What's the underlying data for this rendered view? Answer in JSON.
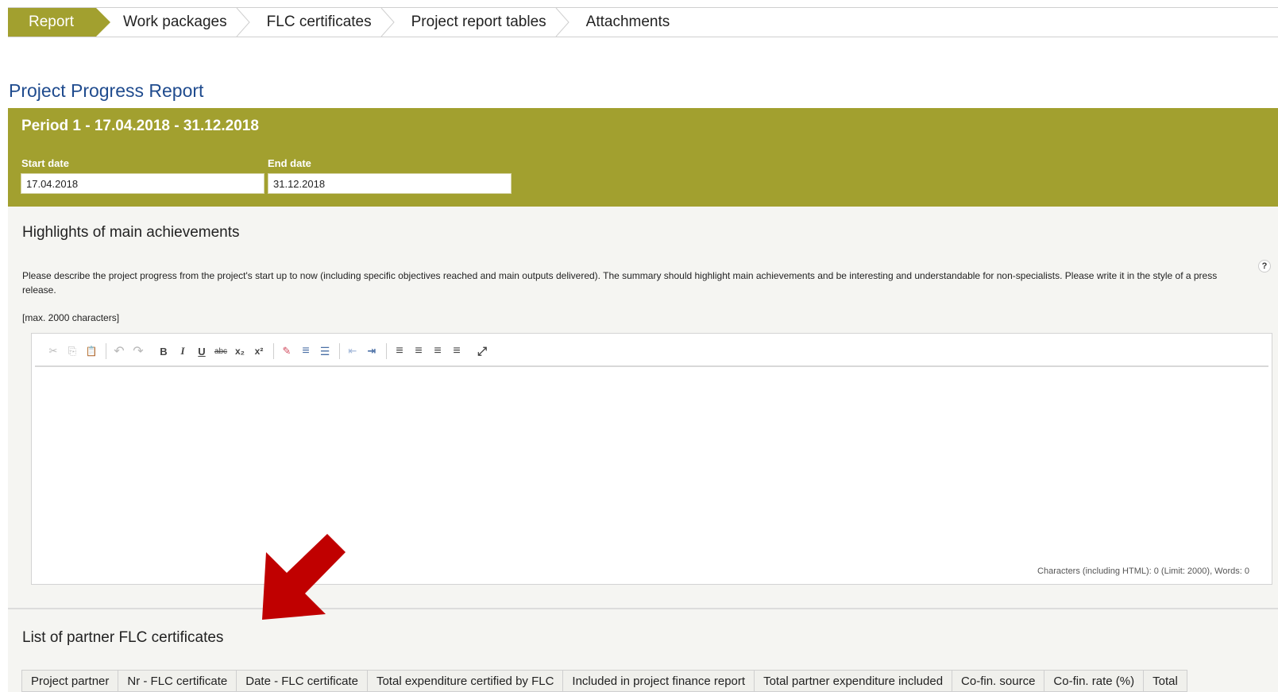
{
  "tabs": [
    {
      "label": "Report",
      "active": true
    },
    {
      "label": "Work packages",
      "active": false
    },
    {
      "label": "FLC certificates",
      "active": false
    },
    {
      "label": "Project report tables",
      "active": false
    },
    {
      "label": "Attachments",
      "active": false
    }
  ],
  "page_title": "Project Progress Report",
  "period": {
    "title": "Period 1 - 17.04.2018 - 31.12.2018",
    "start_label": "Start date",
    "start_value": "17.04.2018",
    "end_label": "End date",
    "end_value": "31.12.2018"
  },
  "highlights": {
    "heading": "Highlights of main achievements",
    "description": "Please describe the project progress from the project's start up to now (including specific objectives reached and main outputs delivered). The summary should highlight main achievements and be interesting and understandable for non-specialists. Please write it in the style of a press release.",
    "max_chars": "[max. 2000 characters]",
    "help": "?",
    "counter": "Characters (including HTML): 0 (Limit: 2000), Words: 0"
  },
  "toolbar": {
    "cut": "✂",
    "copy": "⎘",
    "paste": "📋",
    "undo": "↶",
    "redo": "↷",
    "bold": "B",
    "italic": "I",
    "underline": "U",
    "strike": "abc",
    "subscript": "x₂",
    "superscript": "x²",
    "remove_format": "✎",
    "numbered_list": "≡",
    "bullet_list": "☰",
    "outdent": "⇤",
    "indent": "⇥",
    "align_left": "≡",
    "align_center": "≡",
    "align_right": "≡",
    "justify": "≡",
    "maximize": "⤢"
  },
  "flc_list": {
    "heading": "List of partner FLC certificates",
    "columns": [
      "Project partner",
      "Nr - FLC certificate",
      "Date - FLC certificate",
      "Total expenditure certified by FLC",
      "Included in project finance report",
      "Total partner expenditure included",
      "Co-fin. source",
      "Co-fin. rate (%)",
      "Total"
    ]
  },
  "colors": {
    "accent": "#a2a02f",
    "title_blue": "#1f4b8e",
    "arrow_red": "#c00000"
  }
}
